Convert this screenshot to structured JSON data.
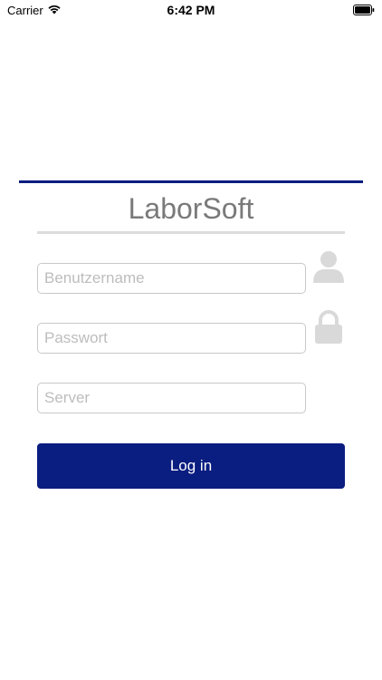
{
  "status_bar": {
    "carrier": "Carrier",
    "time": "6:42 PM",
    "wifi_icon": "wifi-icon",
    "battery_icon": "battery-full-icon"
  },
  "app": {
    "title": "LaborSoft",
    "accent_color": "#0a1d80",
    "divider_color": "#dcdcdc"
  },
  "form": {
    "username": {
      "placeholder": "Benutzername",
      "value": "",
      "icon": "user-icon"
    },
    "password": {
      "placeholder": "Passwort",
      "value": "",
      "icon": "lock-icon"
    },
    "server": {
      "placeholder": "Server",
      "value": ""
    },
    "login_label": "Log in"
  }
}
